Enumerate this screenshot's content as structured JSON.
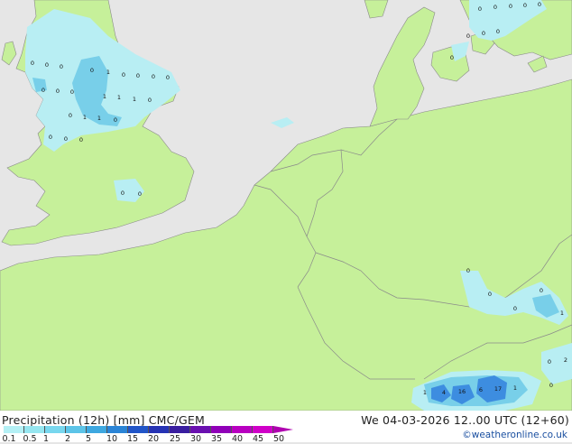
{
  "header": {
    "title": "Precipitation (12h) [mm] CMC/GEM",
    "valid_time": "We 04-03-2026 12..00 UTC (12+60)",
    "credit": "©weatheronline.co.uk"
  },
  "legend": {
    "labels": [
      "0.1",
      "0.5",
      "1",
      "2",
      "5",
      "10",
      "15",
      "20",
      "25",
      "30",
      "35",
      "40",
      "45",
      "50"
    ],
    "colors": [
      "#b4f0f5",
      "#96e6f0",
      "#78d7ee",
      "#5cc4e8",
      "#3ea8e0",
      "#2a84d6",
      "#2155c8",
      "#2633b4",
      "#3a1ea0",
      "#6a10b0",
      "#9000b8",
      "#b800c0",
      "#d000c8"
    ]
  },
  "colors": {
    "sea": "#e6e6e6",
    "land": "#c6f09a",
    "border": "#8a8a8a",
    "precip_light": "#b8eef3",
    "precip_medium": "#78cfe9",
    "precip_heavy": "#3d8de0"
  },
  "values": [
    {
      "text": "0"
    },
    {
      "text": "0"
    },
    {
      "text": "0"
    },
    {
      "text": "0"
    },
    {
      "text": "1"
    },
    {
      "text": "0"
    },
    {
      "text": "0"
    },
    {
      "text": "0"
    },
    {
      "text": "0"
    },
    {
      "text": "0"
    },
    {
      "text": "0"
    },
    {
      "text": "0"
    },
    {
      "text": "1"
    },
    {
      "text": "1"
    },
    {
      "text": "1"
    },
    {
      "text": "0"
    },
    {
      "text": "0"
    },
    {
      "text": "1"
    },
    {
      "text": "1"
    },
    {
      "text": "0"
    },
    {
      "text": "0"
    },
    {
      "text": "0"
    },
    {
      "text": "0"
    },
    {
      "text": "0"
    },
    {
      "text": "0"
    },
    {
      "text": "0"
    },
    {
      "text": "0"
    },
    {
      "text": "0"
    },
    {
      "text": "0"
    },
    {
      "text": "0"
    },
    {
      "text": "0"
    },
    {
      "text": "0"
    },
    {
      "text": "0"
    },
    {
      "text": "0"
    },
    {
      "text": "0"
    },
    {
      "text": "0"
    },
    {
      "text": "0"
    },
    {
      "text": "0"
    },
    {
      "text": "1"
    },
    {
      "text": "0"
    },
    {
      "text": "2"
    },
    {
      "text": "0"
    },
    {
      "text": "1"
    },
    {
      "text": "4"
    },
    {
      "text": "16"
    },
    {
      "text": "6"
    },
    {
      "text": "17"
    },
    {
      "text": "1"
    }
  ]
}
